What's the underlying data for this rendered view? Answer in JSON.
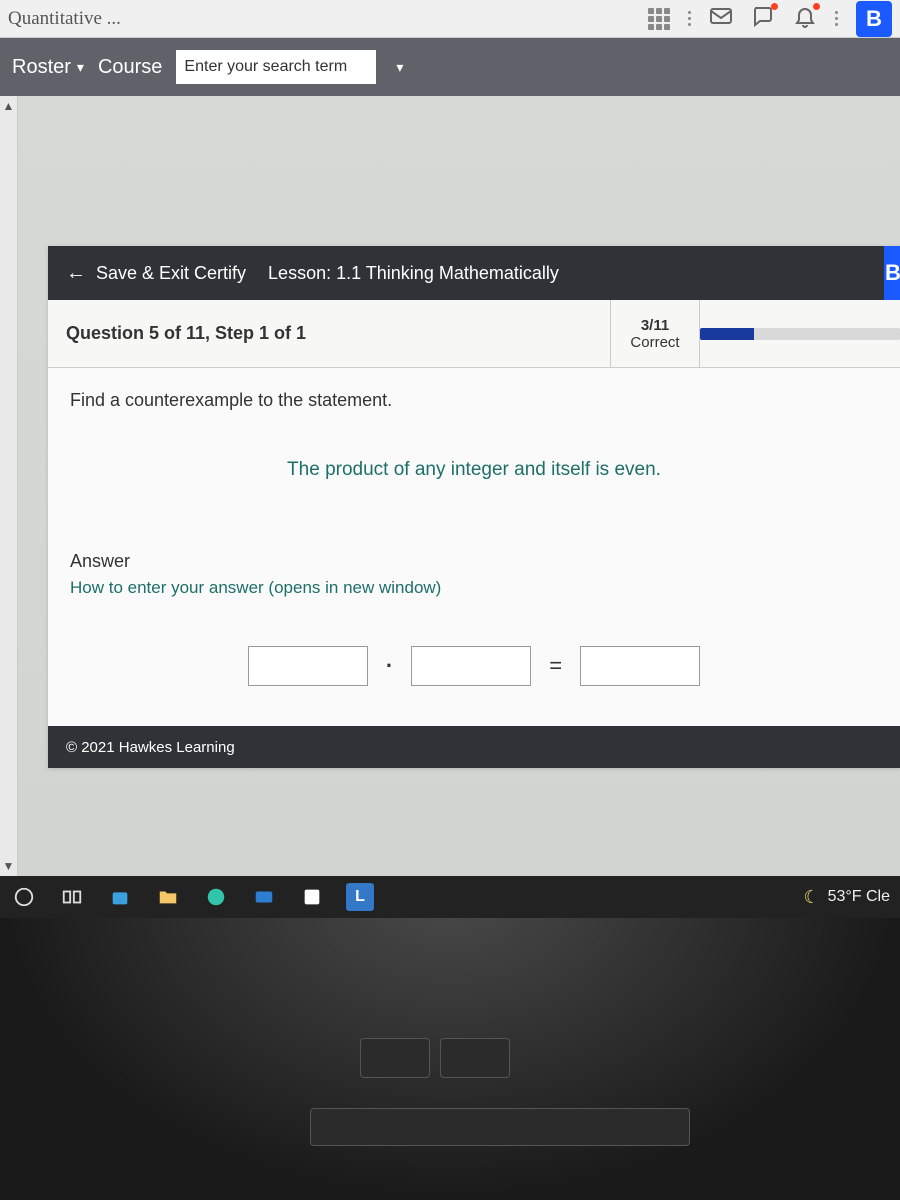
{
  "browser": {
    "address_fragment": "Quantitative ...",
    "b_badge": "B"
  },
  "lms_nav": {
    "roster": "Roster",
    "course": "Course",
    "search_placeholder": "Enter your search term"
  },
  "lesson": {
    "save_exit": "Save & Exit Certify",
    "title": "Lesson: 1.1 Thinking Mathematically",
    "right_badge": "B",
    "question_header": "Question 5 of 11, Step 1 of 1",
    "score": {
      "frac": "3/11",
      "label": "Correct",
      "percent": 27
    },
    "prompt": "Find a counterexample to the statement.",
    "statement": "The product of any integer and itself is even.",
    "answer_label": "Answer",
    "answer_help": "How to enter your answer (opens in new window)",
    "dot": "·",
    "equals": "=",
    "copyright": "© 2021 Hawkes Learning"
  },
  "taskbar": {
    "weather": "53°F  Cle"
  }
}
